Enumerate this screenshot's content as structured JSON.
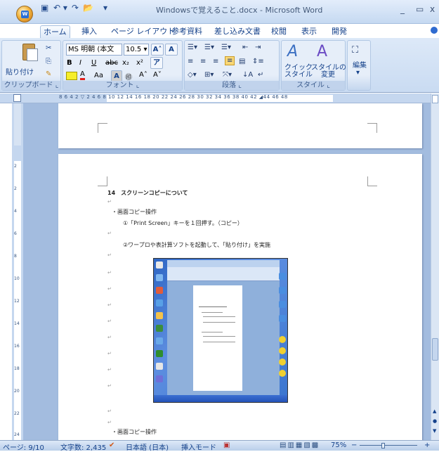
{
  "window": {
    "title": "Windowsで覚えること.docx - Microsoft Word",
    "min": "_",
    "max": "▭",
    "close": "x"
  },
  "qat": {
    "save": "▣",
    "undo": "↶ ▾",
    "redo": "↷",
    "open": "📂",
    "more": "▾"
  },
  "tabs": [
    "ホーム",
    "挿入",
    "ページ レイアウト",
    "参考資料",
    "差し込み文書",
    "校閲",
    "表示",
    "開発"
  ],
  "active_tab": "ホーム",
  "ribbon": {
    "clipboard": {
      "label": "クリップボード",
      "paste": "貼り付け"
    },
    "font": {
      "label": "フォント",
      "font_name": "MS 明朝 (本文",
      "font_size": "10.5",
      "bold": "B",
      "italic": "I",
      "underline": "U",
      "strike": "abc",
      "sub": "x₂",
      "sup": "x²",
      "text_color": "A",
      "aa": "Aa",
      "char_border": "A",
      "enclose": "㊞",
      "grow": "A˄",
      "shrink": "A˅"
    },
    "paragraph": {
      "label": "段落"
    },
    "styles": {
      "label": "スタイル",
      "quick": "クイック\nスタイル",
      "change": "スタイルの\n変更"
    },
    "editing": {
      "label": "編集"
    }
  },
  "ruler": {
    "text": "8  6  4  2  ▽  2  4  6  8  10  12  14  16  18  20  22  24  26  28  30  32  34  36  38  40  42  ◢44  46  48"
  },
  "vruler": [
    "2",
    "2",
    "4",
    "6",
    "8",
    "10",
    "12",
    "14",
    "16",
    "18",
    "20",
    "22",
    "24"
  ],
  "document": {
    "heading": "14　スクリーンコピーについて",
    "bullet1": "・画面コピー操作",
    "step1": "①「Print Screen」キーを１回押す。（コピー）",
    "step2": "②ワープロや表計算ソフトを起動して、「貼り付け」を実施",
    "bullet2": "・画面コピー操作",
    "para_mark": "↵"
  },
  "status": {
    "page": "ページ: 9/10",
    "words": "文字数: 2,435",
    "lang": "日本語 (日本)",
    "mode": "挿入モード",
    "zoom": "75%",
    "zoom_minus": "−",
    "zoom_plus": "+"
  }
}
